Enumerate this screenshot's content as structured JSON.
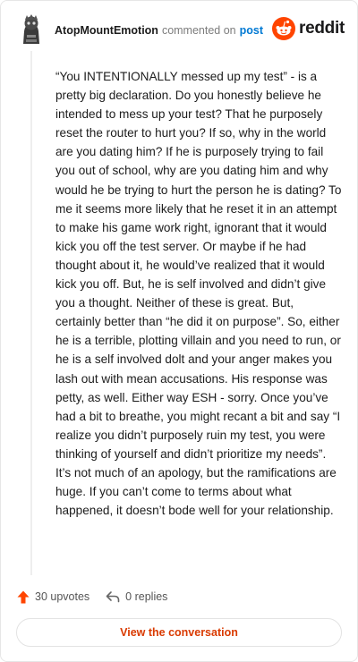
{
  "comment": {
    "author": "AtopMountEmotion",
    "action": "commented on",
    "target": "post",
    "body": "“You INTENTIONALLY messed up my test” - is a pretty big declaration. Do you honestly believe he intended to mess up your test? That he purposely reset the router to hurt you? If so, why in the world are you dating him? If he is purposely trying to fail you out of school, why are you dating him and why would he be trying to hurt the person he is dating? To me it seems more likely that he reset it in an attempt to make his game work right, ignorant that it would kick you off the test server. Or maybe if he had thought about it, he would’ve realized that it would kick you off. But, he is self involved and didn’t give you a thought. Neither of these is great. But, certainly better than “he did it on purpose”. So, either he is a terrible, plotting villain and you need to run, or he is a self involved dolt and your anger makes you lash out with mean accusations. His response was petty, as well. Either way ESH - sorry. Once you’ve had a bit to breathe, you might recant a bit and say “I realize you didn’t purposely ruin my test, you were thinking of yourself and didn’t prioritize my needs”. It’s not much of an apology, but the ramifications are huge. If you can’t come to terms about what happened, it doesn’t bode well for your relationship."
  },
  "brand": {
    "name": "reddit",
    "color": "#ff4500",
    "icon": "reddit-snoo-icon"
  },
  "footer": {
    "upvotes": "30 upvotes",
    "replies": "0 replies",
    "upvote_icon": "upvote-arrow-icon",
    "reply_icon": "reply-arrow-icon"
  },
  "cta": {
    "label": "View the conversation"
  },
  "colors": {
    "accent": "#d93a00",
    "link": "#0079d3",
    "upvote": "#ff4500"
  }
}
